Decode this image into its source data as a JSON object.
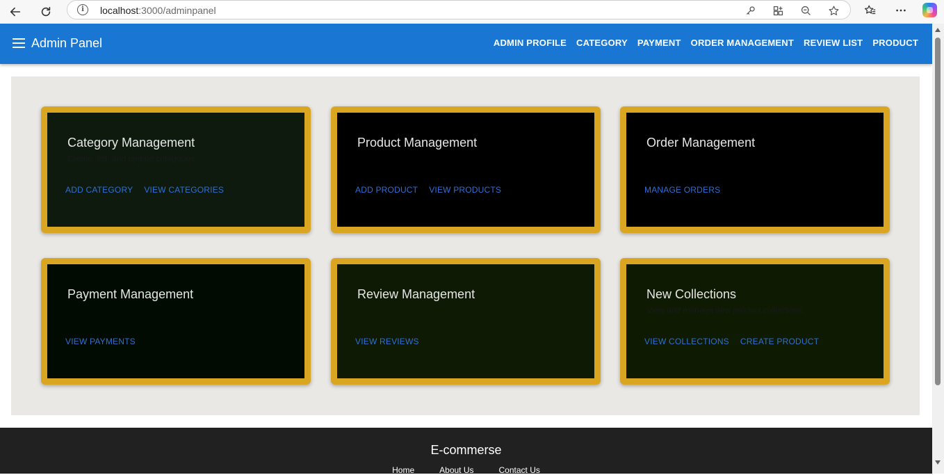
{
  "browser": {
    "url_host": "localhost",
    "url_path": ":3000/adminpanel"
  },
  "appbar": {
    "title": "Admin Panel",
    "nav": [
      "ADMIN PROFILE",
      "CATEGORY",
      "PAYMENT",
      "ORDER MANAGEMENT",
      "REVIEW LIST",
      "PRODUCT"
    ]
  },
  "colors": {
    "appbar": "#1976d2",
    "card_border": "#daa520",
    "link": "#2f6fd6",
    "footer": "#212121"
  },
  "cards": [
    {
      "title": "Category Management",
      "description": "Create, list, and update categories.",
      "actions": [
        "ADD CATEGORY",
        "VIEW CATEGORIES"
      ],
      "bg": "#0e1a0e"
    },
    {
      "title": "Product Management",
      "description": "",
      "actions": [
        "ADD PRODUCT",
        "VIEW PRODUCTS"
      ],
      "bg": "#000000"
    },
    {
      "title": "Order Management",
      "description": "",
      "actions": [
        "MANAGE ORDERS"
      ],
      "bg": "#000000"
    },
    {
      "title": "Payment Management",
      "description": "",
      "actions": [
        "VIEW PAYMENTS"
      ],
      "bg": "#020b02"
    },
    {
      "title": "Review Management",
      "description": "",
      "actions": [
        "VIEW REVIEWS"
      ],
      "bg": "#0e1a04"
    },
    {
      "title": "New Collections",
      "description": "View and manage new product collections.",
      "actions": [
        "VIEW COLLECTIONS",
        "CREATE PRODUCT"
      ],
      "bg": "#0e1a02"
    }
  ],
  "footer": {
    "title": "E-commerse",
    "links": [
      "Home",
      "About Us",
      "Contact Us"
    ]
  }
}
